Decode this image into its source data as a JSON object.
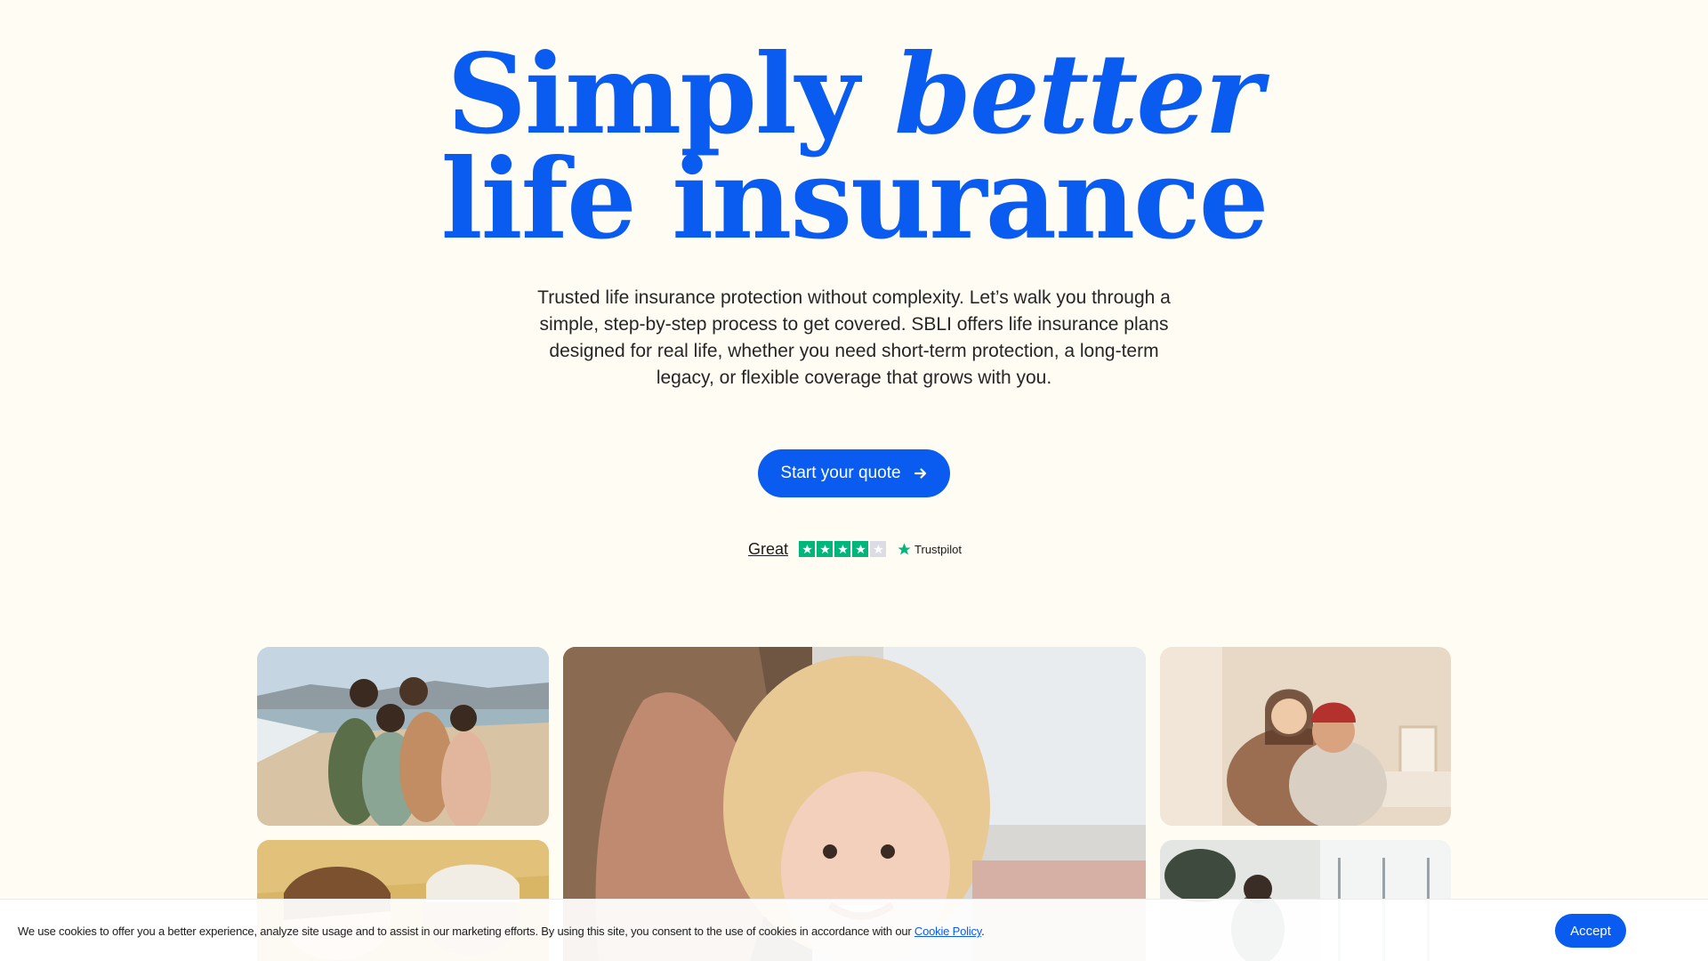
{
  "hero": {
    "headline_line1_plain": "Simply ",
    "headline_line1_em": "better",
    "headline_line2": "life insurance",
    "subtitle": "Trusted life insurance protection without complexity. Let’s walk you through a simple, step-by-step process to get covered. SBLI offers life insurance plans designed for real life, whether you need short-term protection, a long-term legacy, or flexible coverage that grows with you.",
    "cta_label": "Start your quote",
    "cta_icon": "arrow-right-icon"
  },
  "trustpilot": {
    "rating_label": "Great",
    "stars_filled": 4,
    "stars_total": 5,
    "brand": "Trustpilot",
    "star_color": "#00b67a",
    "empty_star_color": "#dcdce6"
  },
  "gallery": {
    "photos": [
      "family-on-beach-photo",
      "father-and-child-photo",
      "couple-embracing-photo",
      "couple-lying-photo",
      "living-room-photo"
    ]
  },
  "cookie_banner": {
    "text": "We use cookies to offer you a better experience, analyze site usage and to assist in our marketing efforts. By using this site, you consent to the use of cookies in accordance with our ",
    "link_label": "Cookie Policy",
    "text_end": ".",
    "accept_label": "Accept"
  },
  "colors": {
    "background": "#fffcf3",
    "brand_blue": "#0a5cf0"
  }
}
